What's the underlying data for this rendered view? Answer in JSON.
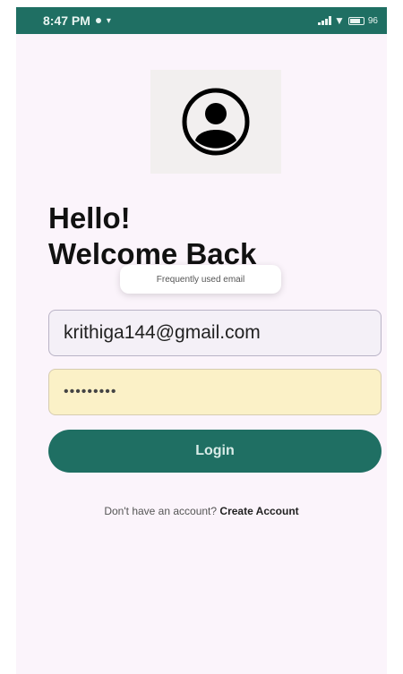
{
  "status_bar": {
    "time": "8:47 PM",
    "battery": "96"
  },
  "header": {
    "greeting_line1": "Hello!",
    "greeting_line2": "Welcome Back"
  },
  "autofill": {
    "tooltip": "Frequently used email"
  },
  "form": {
    "email_value": "krithiga144@gmail.com",
    "password_value": "•••••••••",
    "login_label": "Login"
  },
  "footer": {
    "prompt": "Don't have an account?",
    "link_label": "Create Account"
  },
  "colors": {
    "primary": "#1f6f63",
    "background": "#fbf4fb",
    "password_bg": "#fbf1c7"
  }
}
